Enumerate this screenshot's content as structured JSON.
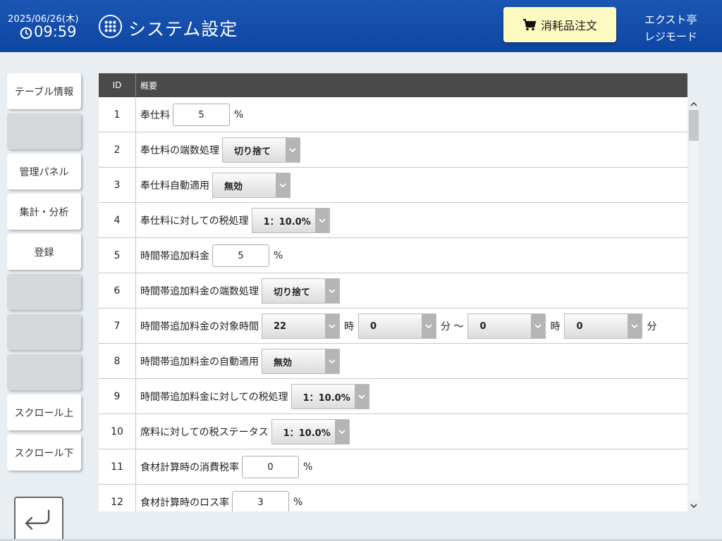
{
  "header": {
    "date": "2025/06/26(木)",
    "time": "09:59",
    "title": "システム設定",
    "order_button": "消耗品注文",
    "store_name": "エクスト亭",
    "mode": "レジモード"
  },
  "sidebar": {
    "items": [
      {
        "label": "テーブル情報"
      },
      {
        "label": ""
      },
      {
        "label": "管理パネル"
      },
      {
        "label": "集計・分析"
      },
      {
        "label": "登録"
      },
      {
        "label": ""
      },
      {
        "label": ""
      },
      {
        "label": ""
      },
      {
        "label": "スクロール上"
      },
      {
        "label": "スクロール下"
      }
    ]
  },
  "table": {
    "headers": {
      "id": "ID",
      "desc": "概要"
    },
    "rows": [
      {
        "id": "1",
        "label": "奉仕料",
        "input": "5",
        "unit": "%"
      },
      {
        "id": "2",
        "label": "奉仕料の端数処理",
        "select": "切り捨て"
      },
      {
        "id": "3",
        "label": "奉仕料自動適用",
        "select": "無効"
      },
      {
        "id": "4",
        "label": "奉仕料に対しての税処理",
        "select": "1：10.0%"
      },
      {
        "id": "5",
        "label": "時間帯追加料金",
        "input": "5",
        "unit": "%"
      },
      {
        "id": "6",
        "label": "時間帯追加料金の端数処理",
        "select": "切り捨て"
      },
      {
        "id": "7",
        "label": "時間帯追加料金の対象時間",
        "start_hour": "22",
        "hour_unit": "時",
        "start_min": "0",
        "min_unit": "分 ～",
        "end_hour": "0",
        "end_hour_unit": "時",
        "end_min": "0",
        "end_min_unit": "分"
      },
      {
        "id": "8",
        "label": "時間帯追加料金の自動適用",
        "select": "無効"
      },
      {
        "id": "9",
        "label": "時間帯追加料金に対しての税処理",
        "select": "1：10.0%"
      },
      {
        "id": "10",
        "label": "席料に対しての税ステータス",
        "select": "1：10.0%"
      },
      {
        "id": "11",
        "label": "食材計算時の消費税率",
        "input": "0",
        "unit": "%"
      },
      {
        "id": "12",
        "label": "食材計算時のロス率",
        "input": "3",
        "unit": "%"
      }
    ]
  },
  "colors": {
    "header_bg": "#1b56b4",
    "order_button_bg": "#fdfac2",
    "table_header_bg": "#4a4a4a"
  }
}
